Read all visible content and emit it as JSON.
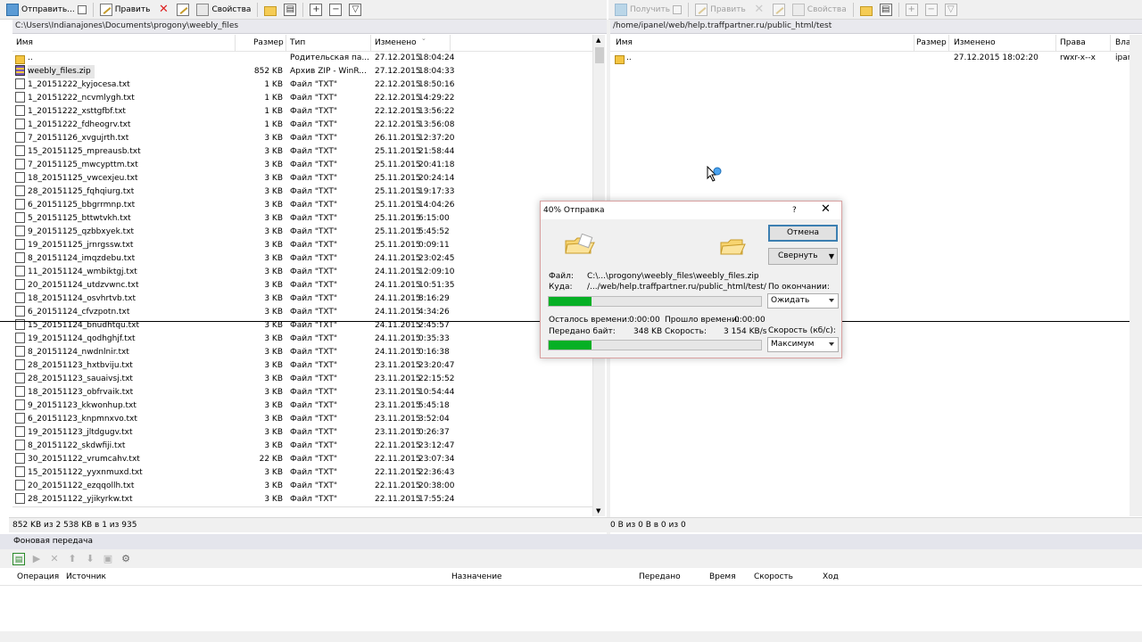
{
  "left_toolbar": {
    "upload": "Отправить...",
    "edit": "Править",
    "properties": "Свойства"
  },
  "right_toolbar": {
    "download": "Получить",
    "edit": "Править",
    "properties": "Свойства"
  },
  "left_panel": {
    "path": "C:\\Users\\Indianajones\\Documents\\progony\\weebly_files",
    "columns": {
      "name": "Имя",
      "size": "Размер",
      "type": "Тип",
      "modified": "Изменено"
    },
    "rows": [
      {
        "name": "..",
        "size": "",
        "type": "Родительская па...",
        "date": "27.12.2015",
        "time": "18:04:24"
      },
      {
        "name": "weebly_files.zip",
        "size": "852 KB",
        "type": "Архив ZIP - WinR...",
        "date": "27.12.2015",
        "time": "18:04:33"
      },
      {
        "name": "1_20151222_kyjocesa.txt",
        "size": "1 KB",
        "type": "Файл \"TXT\"",
        "date": "22.12.2015",
        "time": "18:50:16"
      },
      {
        "name": "1_20151222_ncvmlygh.txt",
        "size": "1 KB",
        "type": "Файл \"TXT\"",
        "date": "22.12.2015",
        "time": "14:29:22"
      },
      {
        "name": "1_20151222_xsttgfbf.txt",
        "size": "1 KB",
        "type": "Файл \"TXT\"",
        "date": "22.12.2015",
        "time": "13:56:22"
      },
      {
        "name": "1_20151222_fdheogrv.txt",
        "size": "1 KB",
        "type": "Файл \"TXT\"",
        "date": "22.12.2015",
        "time": "13:56:08"
      },
      {
        "name": "7_20151126_xvgujrth.txt",
        "size": "3 KB",
        "type": "Файл \"TXT\"",
        "date": "26.11.2015",
        "time": "12:37:20"
      },
      {
        "name": "15_20151125_mpreausb.txt",
        "size": "3 KB",
        "type": "Файл \"TXT\"",
        "date": "25.11.2015",
        "time": "21:58:44"
      },
      {
        "name": "7_20151125_mwcypttm.txt",
        "size": "3 KB",
        "type": "Файл \"TXT\"",
        "date": "25.11.2015",
        "time": "20:41:18"
      },
      {
        "name": "18_20151125_vwcexjeu.txt",
        "size": "3 KB",
        "type": "Файл \"TXT\"",
        "date": "25.11.2015",
        "time": "20:24:14"
      },
      {
        "name": "28_20151125_fqhqiurg.txt",
        "size": "3 KB",
        "type": "Файл \"TXT\"",
        "date": "25.11.2015",
        "time": "19:17:33"
      },
      {
        "name": "6_20151125_bbgrrmnp.txt",
        "size": "3 KB",
        "type": "Файл \"TXT\"",
        "date": "25.11.2015",
        "time": "14:04:26"
      },
      {
        "name": "5_20151125_bttwtvkh.txt",
        "size": "3 KB",
        "type": "Файл \"TXT\"",
        "date": "25.11.2015",
        "time": "6:15:00"
      },
      {
        "name": "9_20151125_qzbbxyek.txt",
        "size": "3 KB",
        "type": "Файл \"TXT\"",
        "date": "25.11.2015",
        "time": "5:45:52"
      },
      {
        "name": "19_20151125_jrnrgssw.txt",
        "size": "3 KB",
        "type": "Файл \"TXT\"",
        "date": "25.11.2015",
        "time": "0:09:11"
      },
      {
        "name": "8_20151124_imqzdebu.txt",
        "size": "3 KB",
        "type": "Файл \"TXT\"",
        "date": "24.11.2015",
        "time": "23:02:45"
      },
      {
        "name": "11_20151124_wmbiktgj.txt",
        "size": "3 KB",
        "type": "Файл \"TXT\"",
        "date": "24.11.2015",
        "time": "12:09:10"
      },
      {
        "name": "20_20151124_utdzvwnc.txt",
        "size": "3 KB",
        "type": "Файл \"TXT\"",
        "date": "24.11.2015",
        "time": "10:51:35"
      },
      {
        "name": "18_20151124_osvhrtvb.txt",
        "size": "3 KB",
        "type": "Файл \"TXT\"",
        "date": "24.11.2015",
        "time": "8:16:29"
      },
      {
        "name": "6_20151124_cfvzpotn.txt",
        "size": "3 KB",
        "type": "Файл \"TXT\"",
        "date": "24.11.2015",
        "time": "4:34:26"
      },
      {
        "name": "15_20151124_bnudhtqu.txt",
        "size": "3 KB",
        "type": "Файл \"TXT\"",
        "date": "24.11.2015",
        "time": "2:45:57"
      },
      {
        "name": "19_20151124_qodhghjf.txt",
        "size": "3 KB",
        "type": "Файл \"TXT\"",
        "date": "24.11.2015",
        "time": "0:35:33"
      },
      {
        "name": "8_20151124_nwdnlnir.txt",
        "size": "3 KB",
        "type": "Файл \"TXT\"",
        "date": "24.11.2015",
        "time": "0:16:38"
      },
      {
        "name": "28_20151123_hxtbviju.txt",
        "size": "3 KB",
        "type": "Файл \"TXT\"",
        "date": "23.11.2015",
        "time": "23:20:47"
      },
      {
        "name": "28_20151123_sauaivsj.txt",
        "size": "3 KB",
        "type": "Файл \"TXT\"",
        "date": "23.11.2015",
        "time": "22:15:52"
      },
      {
        "name": "18_20151123_obfrvaik.txt",
        "size": "3 KB",
        "type": "Файл \"TXT\"",
        "date": "23.11.2015",
        "time": "10:54:44"
      },
      {
        "name": "9_20151123_kkwonhup.txt",
        "size": "3 KB",
        "type": "Файл \"TXT\"",
        "date": "23.11.2015",
        "time": "5:45:18"
      },
      {
        "name": "6_20151123_knpmnxvo.txt",
        "size": "3 KB",
        "type": "Файл \"TXT\"",
        "date": "23.11.2015",
        "time": "3:52:04"
      },
      {
        "name": "19_20151123_jltdgugv.txt",
        "size": "3 KB",
        "type": "Файл \"TXT\"",
        "date": "23.11.2015",
        "time": "0:26:37"
      },
      {
        "name": "8_20151122_skdwfiji.txt",
        "size": "3 KB",
        "type": "Файл \"TXT\"",
        "date": "22.11.2015",
        "time": "23:12:47"
      },
      {
        "name": "30_20151122_vrumcahv.txt",
        "size": "22 KB",
        "type": "Файл \"TXT\"",
        "date": "22.11.2015",
        "time": "23:07:34"
      },
      {
        "name": "15_20151122_yyxnmuxd.txt",
        "size": "3 KB",
        "type": "Файл \"TXT\"",
        "date": "22.11.2015",
        "time": "22:36:43"
      },
      {
        "name": "20_20151122_ezqqollh.txt",
        "size": "3 KB",
        "type": "Файл \"TXT\"",
        "date": "22.11.2015",
        "time": "20:38:00"
      },
      {
        "name": "28_20151122_yjikyrkw.txt",
        "size": "3 KB",
        "type": "Файл \"TXT\"",
        "date": "22.11.2015",
        "time": "17:55:24"
      }
    ],
    "status": "852 KB из 2 538 KB в 1 из 935"
  },
  "right_panel": {
    "path": "/home/ipanel/web/help.traffpartner.ru/public_html/test",
    "columns": {
      "name": "Имя",
      "size": "Размер",
      "modified": "Изменено",
      "rights": "Права",
      "owner": "Вла"
    },
    "rows": [
      {
        "name": "..",
        "date": "27.12.2015 18:02:20",
        "rights": "rwxr-x--x",
        "owner": "ipar"
      }
    ],
    "status": "0 B из 0 B в 0 из 0"
  },
  "background_transfer": {
    "title": "Фоновая передача",
    "columns": {
      "operation": "Операция",
      "source": "Источник",
      "destination": "Назначение",
      "transferred": "Передано",
      "time": "Время",
      "speed": "Скорость",
      "progress": "Ход"
    }
  },
  "dialog": {
    "title": "40% Отправка",
    "help": "?",
    "cancel": "Отмена",
    "minimize": "Свернуть",
    "file_label": "Файл:",
    "file_value": "C:\\...\\progony\\weebly_files\\weebly_files.zip",
    "target_label": "Куда:",
    "target_value": "/.../web/help.traffpartner.ru/public_html/test/",
    "on_finish_label": "По окончании:",
    "on_finish_value": "Ожидать",
    "remaining_label": "Осталось времени:",
    "remaining_value": "0:00:00",
    "elapsed_label": "Прошло времени:",
    "elapsed_value": "0:00:00",
    "transferred_label": "Передано байт:",
    "transferred_value": "348 KB",
    "speed_label": "Скорость:",
    "speed_value": "3 154 KB/s",
    "speed_limit_label": "Скорость (кб/с):",
    "speed_limit_value": "Максимум",
    "file_progress": 0.2,
    "total_progress": 0.2
  },
  "colors": {
    "progress": "#06b025",
    "accent": "#3c7fb1"
  }
}
